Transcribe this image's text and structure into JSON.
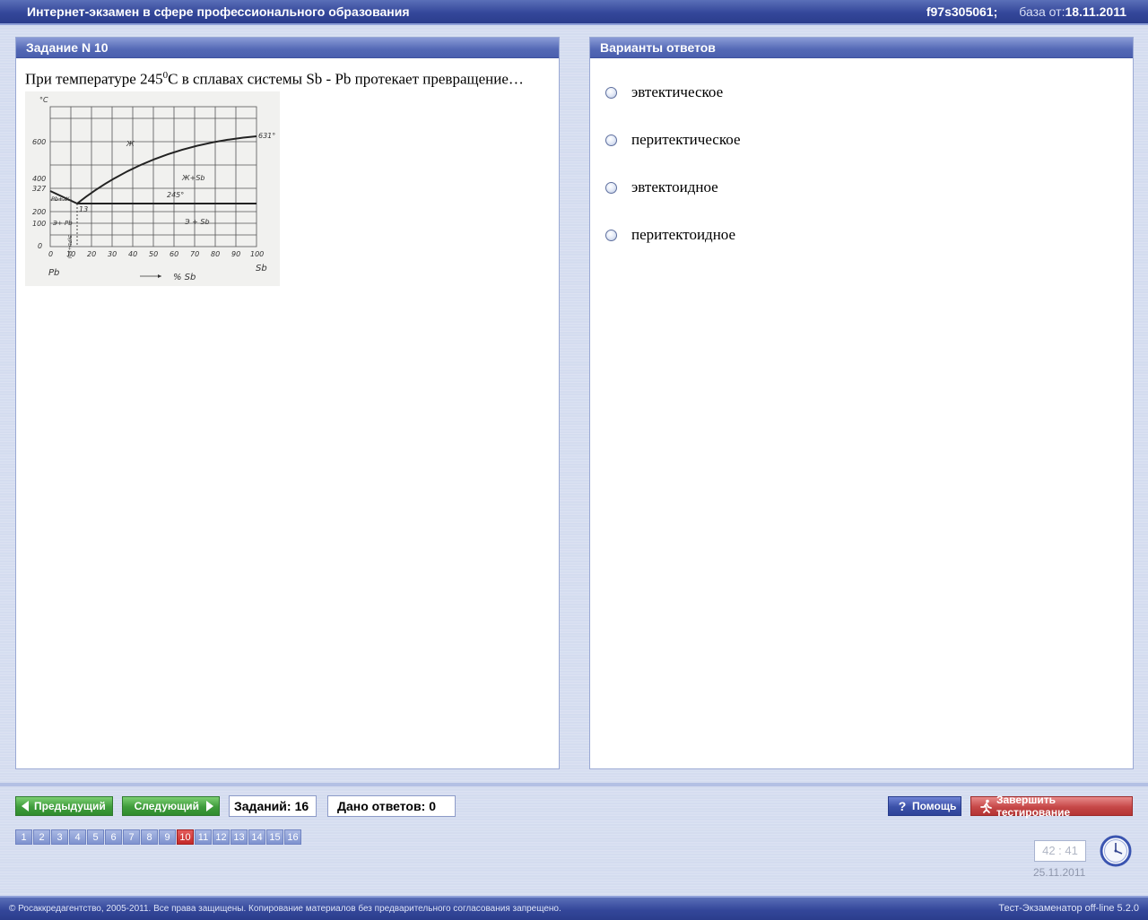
{
  "header": {
    "title": "Интернет-экзамен в сфере профессионального образования",
    "session_id": "f97s305061;",
    "base_label": "база от:",
    "base_date": "18.11.2011"
  },
  "question": {
    "heading": "Задание N 10",
    "text_before": "При температуре 245",
    "degree": "0",
    "text_after": "С в сплавах системы  Sb -  Pb протекает превращение…",
    "diagram": {
      "unit_label": "°С",
      "y_ticks": [
        "600",
        "400",
        "327",
        "200",
        "100",
        "0"
      ],
      "x_ticks": [
        "0",
        "10",
        "20",
        "30",
        "40",
        "50",
        "60",
        "70",
        "80",
        "90",
        "100"
      ],
      "point_630": "631°",
      "liquid_label": "Ж",
      "liquid_sb_label": "Ж+Sb",
      "eutectic_temp_label": "245°",
      "eutectic_pct": "13",
      "pb_liquid_label": "Pb+Ж",
      "e_sb_label": "Э + Sb",
      "e_pb_label": "Э+ Pb",
      "e_label_vertical": "Э(Pb+Sb)",
      "left_element": "Pb",
      "right_element": "Sb",
      "axis_caption": "% Sb"
    }
  },
  "answers": {
    "heading": "Варианты ответов",
    "options": [
      "эвтектическое",
      "перитектическое",
      "эвтектоидное",
      "перитектоидное"
    ]
  },
  "nav": {
    "prev_label": "Предыдущий",
    "next_label": "Следующий",
    "tasks_label": "Заданий:",
    "tasks_count": "16",
    "answered_label": "Дано ответов:",
    "answered_count": "0",
    "help_label": "Помощь",
    "finish_label": "Завершить тестирование",
    "pages": [
      "1",
      "2",
      "3",
      "4",
      "5",
      "6",
      "7",
      "8",
      "9",
      "10",
      "11",
      "12",
      "13",
      "14",
      "15",
      "16"
    ],
    "current_page": "10"
  },
  "status": {
    "timer": "42 : 41",
    "date": "25.11.2011"
  },
  "footer": {
    "copyright": "© Росаккредагентство, 2005-2011. Все права защищены. Копирование материалов без предварительного согласования запрещено.",
    "version": "Тест-Экзаменатор off-line 5.2.0"
  }
}
